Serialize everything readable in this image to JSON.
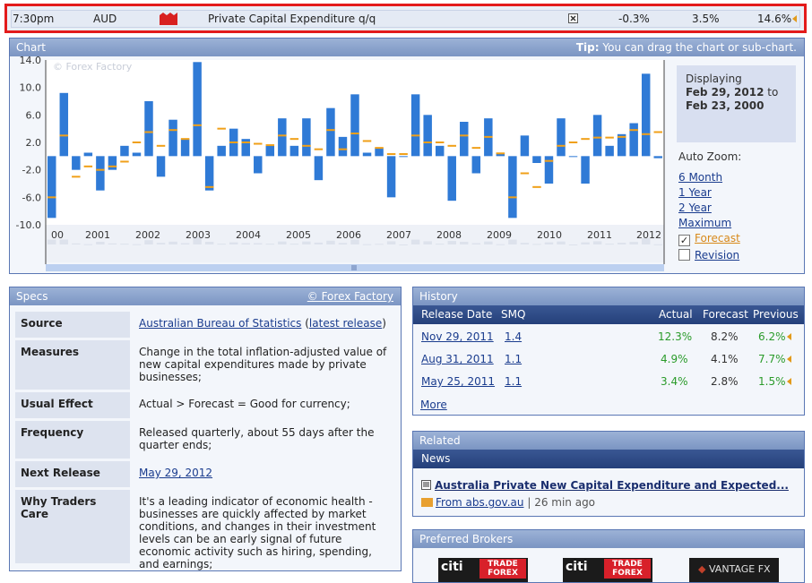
{
  "event": {
    "time": "7:30pm",
    "currency": "AUD",
    "impact_icon": "high-impact-folder-icon",
    "title": "Private Capital Expenditure q/q",
    "detail_icon": "detail-icon",
    "actual": "-0.3%",
    "forecast": "3.5%",
    "previous": "14.6%"
  },
  "chart": {
    "header": "Chart",
    "tip_label": "Tip:",
    "tip_text": "You can drag the chart or sub-chart.",
    "displaying_label": "Displaying",
    "from_date": "Feb 29, 2012",
    "to_word": "to",
    "to_date": "Feb 23, 2000",
    "watermark": "© Forex Factory",
    "auto_zoom_label": "Auto Zoom:",
    "zoom_options": [
      "6 Month",
      "1 Year",
      "2 Year",
      "Maximum"
    ],
    "forecast_label": "Forecast",
    "forecast_checked": true,
    "revision_label": "Revision",
    "revision_checked": false
  },
  "chart_data": {
    "type": "bar",
    "y_ticks": [
      "14.0",
      "10.0",
      "6.0",
      "2.0",
      "-2.0",
      "-6.0",
      "-10.0"
    ],
    "ylim": [
      -10.0,
      14.0
    ],
    "x_labels": [
      "00",
      "2001",
      "2002",
      "2003",
      "2004",
      "2005",
      "2006",
      "2007",
      "2008",
      "2009",
      "2010",
      "2011",
      "2012"
    ],
    "series": [
      {
        "name": "Actual",
        "values": [
          -9.0,
          9.2,
          -2.0,
          0.5,
          -5.0,
          -2.0,
          1.5,
          0.5,
          8.0,
          -3.0,
          5.3,
          2.5,
          13.7,
          -5.0,
          1.5,
          4.0,
          2.5,
          -2.5,
          1.5,
          5.5,
          1.5,
          5.5,
          -3.5,
          7.0,
          2.8,
          9.0,
          0.5,
          1.2,
          -6.0,
          0.0,
          9.0,
          6.0,
          1.5,
          -6.5,
          5.0,
          -2.5,
          5.5,
          0.5,
          -9.0,
          3.0,
          -1.0,
          -4.0,
          5.5,
          0.0,
          -4.0,
          6.0,
          1.5,
          3.2,
          4.8,
          12.0,
          -0.3
        ]
      },
      {
        "name": "Forecast",
        "values": [
          -6.0,
          3.0,
          -3.0,
          -1.5,
          -2.0,
          -1.5,
          -0.8,
          2.0,
          3.5,
          1.5,
          3.8,
          2.5,
          4.5,
          -4.5,
          4.0,
          2.0,
          2.0,
          1.8,
          1.6,
          3.0,
          2.5,
          1.5,
          1.0,
          3.8,
          1.0,
          3.3,
          2.2,
          1.2,
          0.3,
          0.3,
          3.0,
          2.0,
          2.0,
          1.5,
          3.0,
          1.2,
          2.8,
          0.4,
          -6.0,
          -2.5,
          -4.5,
          -0.7,
          1.5,
          2.0,
          2.5,
          2.7,
          2.7,
          2.8,
          3.8,
          3.2,
          3.5
        ]
      }
    ],
    "colors": {
      "actual": "#2f7ad6",
      "forecast": "#f0a019"
    }
  },
  "specs": {
    "header": "Specs",
    "credit": "© Forex Factory",
    "source_label": "Source",
    "source_link": "Australian Bureau of Statistics",
    "source_open": "(",
    "source_latest": "latest release",
    "source_close": ")",
    "measures_label": "Measures",
    "measures_text": "Change in the total inflation-adjusted value of new capital expenditures made by private businesses;",
    "effect_label": "Usual Effect",
    "effect_text": "Actual > Forecast = Good for currency;",
    "frequency_label": "Frequency",
    "frequency_text": "Released quarterly, about 55 days after the quarter ends;",
    "next_label": "Next Release",
    "next_date": "May 29, 2012",
    "why_label": "Why Traders Care",
    "why_text": "It's a leading indicator of economic health - businesses are quickly affected by market conditions, and changes in their investment levels can be an early signal of future economic activity such as hiring, spending, and earnings;"
  },
  "history": {
    "header": "History",
    "columns": [
      "Release Date",
      "SMQ",
      "Actual",
      "Forecast",
      "Previous"
    ],
    "rows": [
      {
        "date": "Nov 29, 2011",
        "smq": "1.4",
        "actual": "12.3%",
        "forecast": "8.2%",
        "previous": "6.2%"
      },
      {
        "date": "Aug 31, 2011",
        "smq": "1.1",
        "actual": "4.9%",
        "forecast": "4.1%",
        "previous": "7.7%"
      },
      {
        "date": "May 25, 2011",
        "smq": "1.1",
        "actual": "3.4%",
        "forecast": "2.8%",
        "previous": "1.5%"
      }
    ],
    "more": "More"
  },
  "related": {
    "header": "Related",
    "news_header": "News",
    "headline": "Australia Private New Capital Expenditure and Expected...",
    "source": "From abs.gov.au",
    "separator": "|",
    "age": "26 min ago"
  },
  "brokers": {
    "header": "Preferred Brokers",
    "items": [
      {
        "logo": "citi",
        "text": "TRADE FOREX"
      },
      {
        "logo": "citi",
        "text": "TRADE FOREX"
      },
      {
        "logo": "",
        "text": "VANTAGE FX"
      }
    ]
  }
}
